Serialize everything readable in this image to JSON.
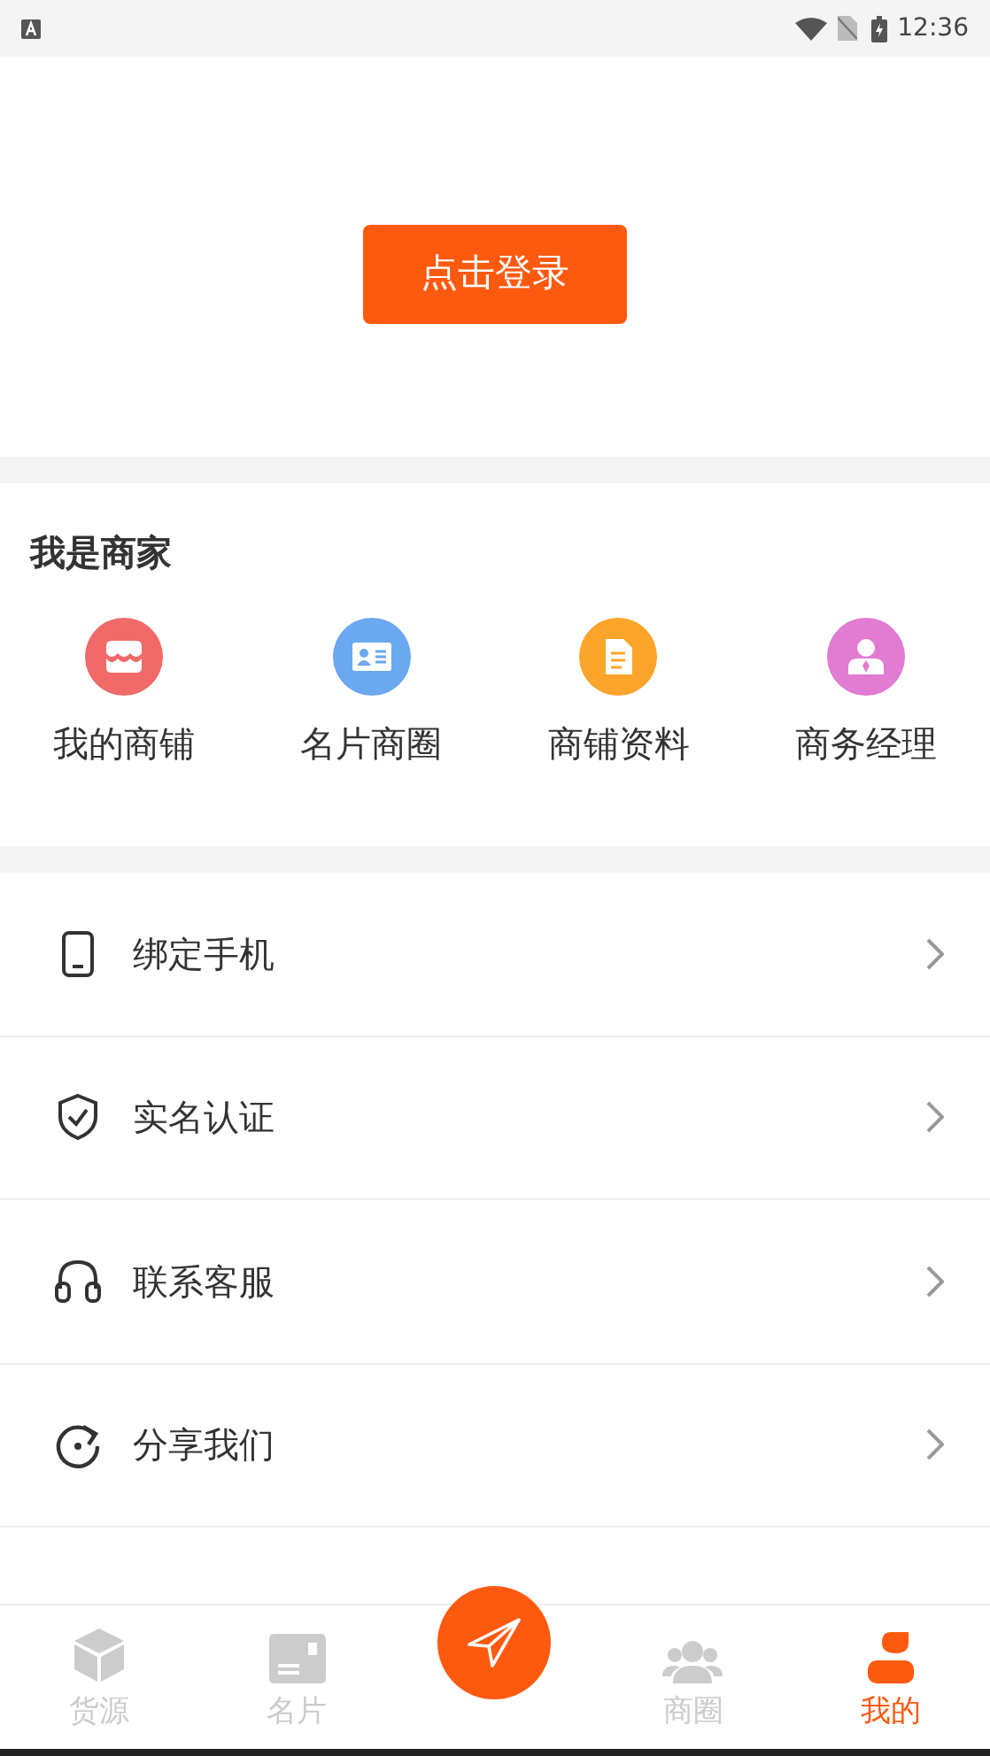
{
  "status_bar": {
    "time": "12:36"
  },
  "login": {
    "button": "点击登录"
  },
  "merchant": {
    "title": "我是商家",
    "items": [
      {
        "label": "我的商铺",
        "color": "#f06a6a"
      },
      {
        "label": "名片商圈",
        "color": "#6aa8ef"
      },
      {
        "label": "商铺资料",
        "color": "#fca52a"
      },
      {
        "label": "商务经理",
        "color": "#e27bd2"
      }
    ]
  },
  "menu": [
    {
      "label": "绑定手机"
    },
    {
      "label": "实名认证"
    },
    {
      "label": "联系客服"
    },
    {
      "label": "分享我们"
    }
  ],
  "tab_bar": [
    {
      "label": "货源",
      "selected": false
    },
    {
      "label": "名片",
      "selected": false
    },
    {
      "label": "商圈",
      "selected": false
    },
    {
      "label": "我的",
      "selected": true
    }
  ]
}
